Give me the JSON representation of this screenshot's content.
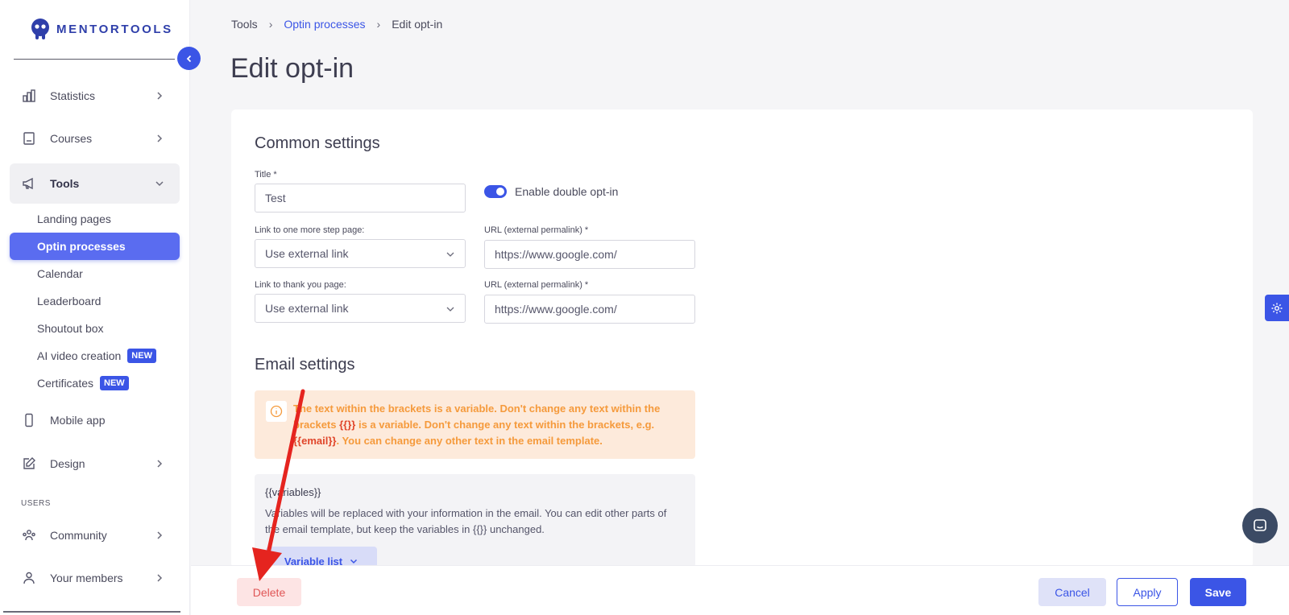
{
  "brand": {
    "name": "MENTORTOOLS"
  },
  "sidebar": {
    "items": [
      {
        "label": "Statistics",
        "icon": "bar-chart-icon"
      },
      {
        "label": "Courses",
        "icon": "book-icon"
      },
      {
        "label": "Tools",
        "icon": "megaphone-icon"
      }
    ],
    "tools_sub": [
      {
        "label": "Landing pages"
      },
      {
        "label": "Optin processes"
      },
      {
        "label": "Calendar"
      },
      {
        "label": "Leaderboard"
      },
      {
        "label": "Shoutout box"
      },
      {
        "label": "AI video creation",
        "badge": "NEW"
      },
      {
        "label": "Certificates",
        "badge": "NEW"
      }
    ],
    "mobile_app": "Mobile app",
    "design": "Design",
    "users_section": "USERS",
    "community": "Community",
    "your_members": "Your members"
  },
  "breadcrumb": {
    "root": "Tools",
    "parent": "Optin processes",
    "current": "Edit opt-in"
  },
  "page": {
    "title": "Edit opt-in"
  },
  "common": {
    "heading": "Common settings",
    "title_label": "Title *",
    "title_value": "Test",
    "double_optin_label": "Enable double opt-in",
    "double_optin_enabled": true,
    "step_label": "Link to one more step page:",
    "step_value": "Use external link",
    "step_url_label": "URL (external permalink) *",
    "step_url_value": "https://www.google.com/",
    "thanks_label": "Link to thank you page:",
    "thanks_value": "Use external link",
    "thanks_url_label": "URL (external permalink) *",
    "thanks_url_value": "https://www.google.com/"
  },
  "email": {
    "heading": "Email settings",
    "alert_part1": "The text within the brackets is a variable. Don't change any text within the brackets ",
    "alert_var1": "{{}}",
    "alert_part2": " is a variable. Don't change any text within the brackets, e.g. ",
    "alert_var2": "{{email}}",
    "alert_part3": ". You can change any other text in the email template.",
    "vars_title": "{{variables}}",
    "vars_desc": "Variables will be replaced with your information in the email. You can edit other parts of the email template, but keep the variables in {{}} unchanged.",
    "vars_button": "Variable list"
  },
  "footer": {
    "delete": "Delete",
    "cancel": "Cancel",
    "apply": "Apply",
    "save": "Save"
  },
  "colors": {
    "accent": "#3b55e6",
    "danger": "#e05656",
    "warning_text": "#f59a3c",
    "annotation_arrow": "#e5241f"
  }
}
